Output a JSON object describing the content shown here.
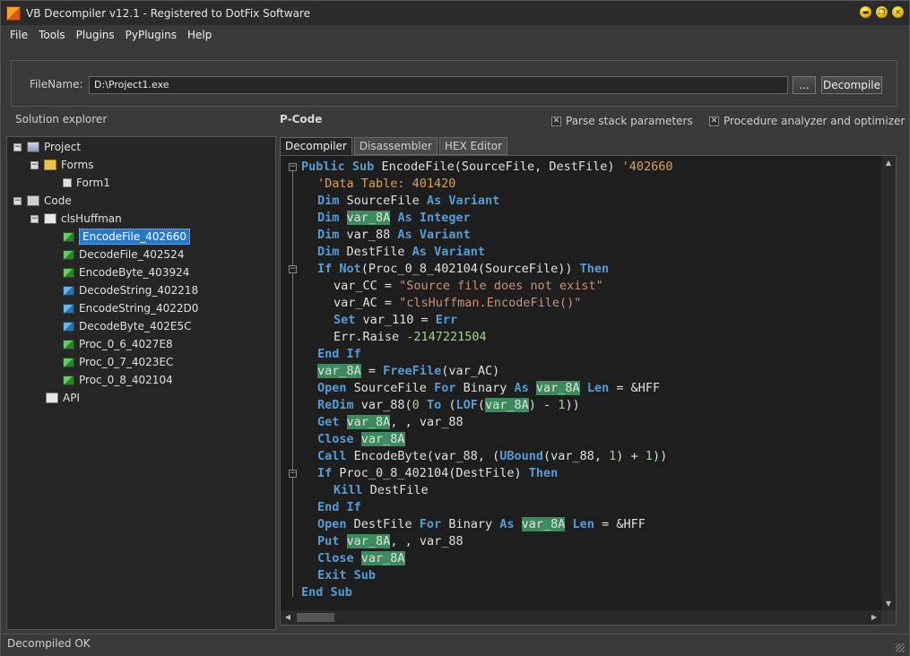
{
  "window": {
    "title": "VB Decompiler v12.1 - Registered to DotFix Software"
  },
  "window_buttons": {
    "minimize": "▬",
    "restore": "❐",
    "close": "✕"
  },
  "menu": [
    "File",
    "Tools",
    "Plugins",
    "PyPlugins",
    "Help"
  ],
  "filename": {
    "label": "FileName:",
    "value": "D:\\Project1.exe",
    "browse_label": "...",
    "decompile_label": "Decompile"
  },
  "solution_explorer": {
    "label": "Solution explorer"
  },
  "pcode": {
    "label": "P-Code"
  },
  "options": {
    "parse_stack": "Parse stack parameters",
    "analyzer": "Procedure analyzer and optimizer"
  },
  "tree": {
    "project": "Project",
    "forms": "Forms",
    "form1": "Form1",
    "code": "Code",
    "class": "clsHuffman",
    "functions": [
      "EncodeFile_402660",
      "DecodeFile_402524",
      "EncodeByte_403924",
      "DecodeString_402218",
      "EncodeString_4022D0",
      "DecodeByte_402E5C",
      "Proc_0_6_4027E8",
      "Proc_0_7_4023EC",
      "Proc_0_8_402104"
    ],
    "api": "API"
  },
  "tabs": [
    "Decompiler",
    "Disassembler",
    "HEX Editor"
  ],
  "code": {
    "l1a": "Public",
    "l1b": " ",
    "l1c": "Sub",
    "l1d": " EncodeFile(SourceFile, DestFile) ",
    "l1e": "'402660",
    "l2": "'Data Table: 401420",
    "l3a": "Dim",
    "l3b": " SourceFile ",
    "l3c": "As",
    "l3d": " ",
    "l3e": "Variant",
    "l4a": "Dim",
    "l4b": " ",
    "l4c": "var_8A",
    "l4d": " ",
    "l4e": "As",
    "l4f": " ",
    "l4g": "Integer",
    "l5a": "Dim",
    "l5b": " var_88 ",
    "l5c": "As",
    "l5d": " ",
    "l5e": "Variant",
    "l6a": "Dim",
    "l6b": " DestFile ",
    "l6c": "As",
    "l6d": " ",
    "l6e": "Variant",
    "l7a": "If",
    "l7b": " ",
    "l7c": "Not",
    "l7d": "(Proc_0_8_402104(SourceFile)) ",
    "l7e": "Then",
    "l8a": "var_CC = ",
    "l8b": "\"Source file does not exist\"",
    "l9a": "var_AC = ",
    "l9b": "\"clsHuffman.EncodeFile()\"",
    "l10a": "Set",
    "l10b": " var_110 = ",
    "l10c": "Err",
    "l11a": "Err.Raise ",
    "l11b": "-2147221504",
    "l12a": "End",
    "l12b": " ",
    "l12c": "If",
    "l13a": "var_8A",
    "l13b": " = ",
    "l13c": "FreeFile",
    "l13d": "(var_AC)",
    "l14a": "Open",
    "l14b": " SourceFile ",
    "l14c": "For",
    "l14d": " Binary ",
    "l14e": "As",
    "l14f": " ",
    "l14g": "var_8A",
    "l14h": " ",
    "l14i": "Len",
    "l14j": " = &HFF",
    "l15a": "ReDim",
    "l15b": " var_88(",
    "l15c": "0",
    "l15d": " ",
    "l15e": "To",
    "l15f": " (",
    "l15g": "LOF",
    "l15h": "(",
    "l15i": "var_8A",
    "l15j": ") - ",
    "l15k": "1",
    "l15l": "))",
    "l16a": "Get",
    "l16b": " ",
    "l16c": "var_8A",
    "l16d": ", , var_88",
    "l17a": "Close",
    "l17b": " ",
    "l17c": "var_8A",
    "l18a": "Call",
    "l18b": " EncodeByte(var_88, (",
    "l18c": "UBound",
    "l18d": "(var_88, ",
    "l18e": "1",
    "l18f": ") + ",
    "l18g": "1",
    "l18h": "))",
    "l19a": "If",
    "l19b": " Proc_0_8_402104(DestFile) ",
    "l19c": "Then",
    "l20a": "Kill",
    "l20b": " DestFile",
    "l21a": "End",
    "l21b": " ",
    "l21c": "If",
    "l22a": "Open",
    "l22b": " DestFile ",
    "l22c": "For",
    "l22d": " Binary ",
    "l22e": "As",
    "l22f": " ",
    "l22g": "var_8A",
    "l22h": " ",
    "l22i": "Len",
    "l22j": " = &HFF",
    "l23a": "Put",
    "l23b": " ",
    "l23c": "var_8A",
    "l23d": ", , var_88",
    "l24a": "Close",
    "l24b": " ",
    "l24c": "var_8A",
    "l25a": "Exit",
    "l25b": " ",
    "l25c": "Sub",
    "l26a": "End",
    "l26b": " ",
    "l26c": "Sub"
  },
  "fold": {
    "minus": "−"
  },
  "scroll": {
    "up": "▲",
    "down": "▼",
    "left": "◀",
    "right": "▶"
  },
  "status": {
    "text": "Decompiled OK"
  },
  "checkmark": "✕",
  "tree_exp": "−"
}
